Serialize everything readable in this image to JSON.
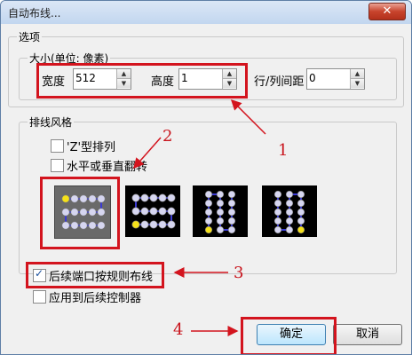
{
  "dialog": {
    "title": "自动布线...",
    "close_glyph": "✕"
  },
  "options": {
    "group_title": "选项",
    "size_group_title": "大小(单位: 像素)",
    "width_label": "宽度",
    "width_value": "512",
    "height_label": "高度",
    "height_value": "1",
    "spacing_label": "行/列间距",
    "spacing_value": "0"
  },
  "style_group": {
    "title": "排线风格",
    "z_order_label": "'Z'型排列",
    "z_order_checked": false,
    "flip_label": "水平或垂直翻转",
    "flip_checked": false,
    "patterns": [
      {
        "name": "horizontal-rows-start-top-left",
        "selected": true
      },
      {
        "name": "horizontal-rows-start-bottom-left",
        "selected": false
      },
      {
        "name": "vertical-columns-start-bottom-left",
        "selected": false
      },
      {
        "name": "vertical-columns-start-bottom-right",
        "selected": false
      }
    ]
  },
  "follow_rule": {
    "label": "后续端口按规则布线",
    "checked": true
  },
  "apply_controller": {
    "label": "应用到后续控制器",
    "checked": false
  },
  "buttons": {
    "ok": "确定",
    "cancel": "取消"
  },
  "annotations": [
    "1",
    "2",
    "3",
    "4"
  ],
  "colors": {
    "annotation_red": "#d3141e",
    "dot_yellow": "#f5e11a",
    "dot_light": "#d6d6f0",
    "line_blue": "#3b3bd6"
  }
}
